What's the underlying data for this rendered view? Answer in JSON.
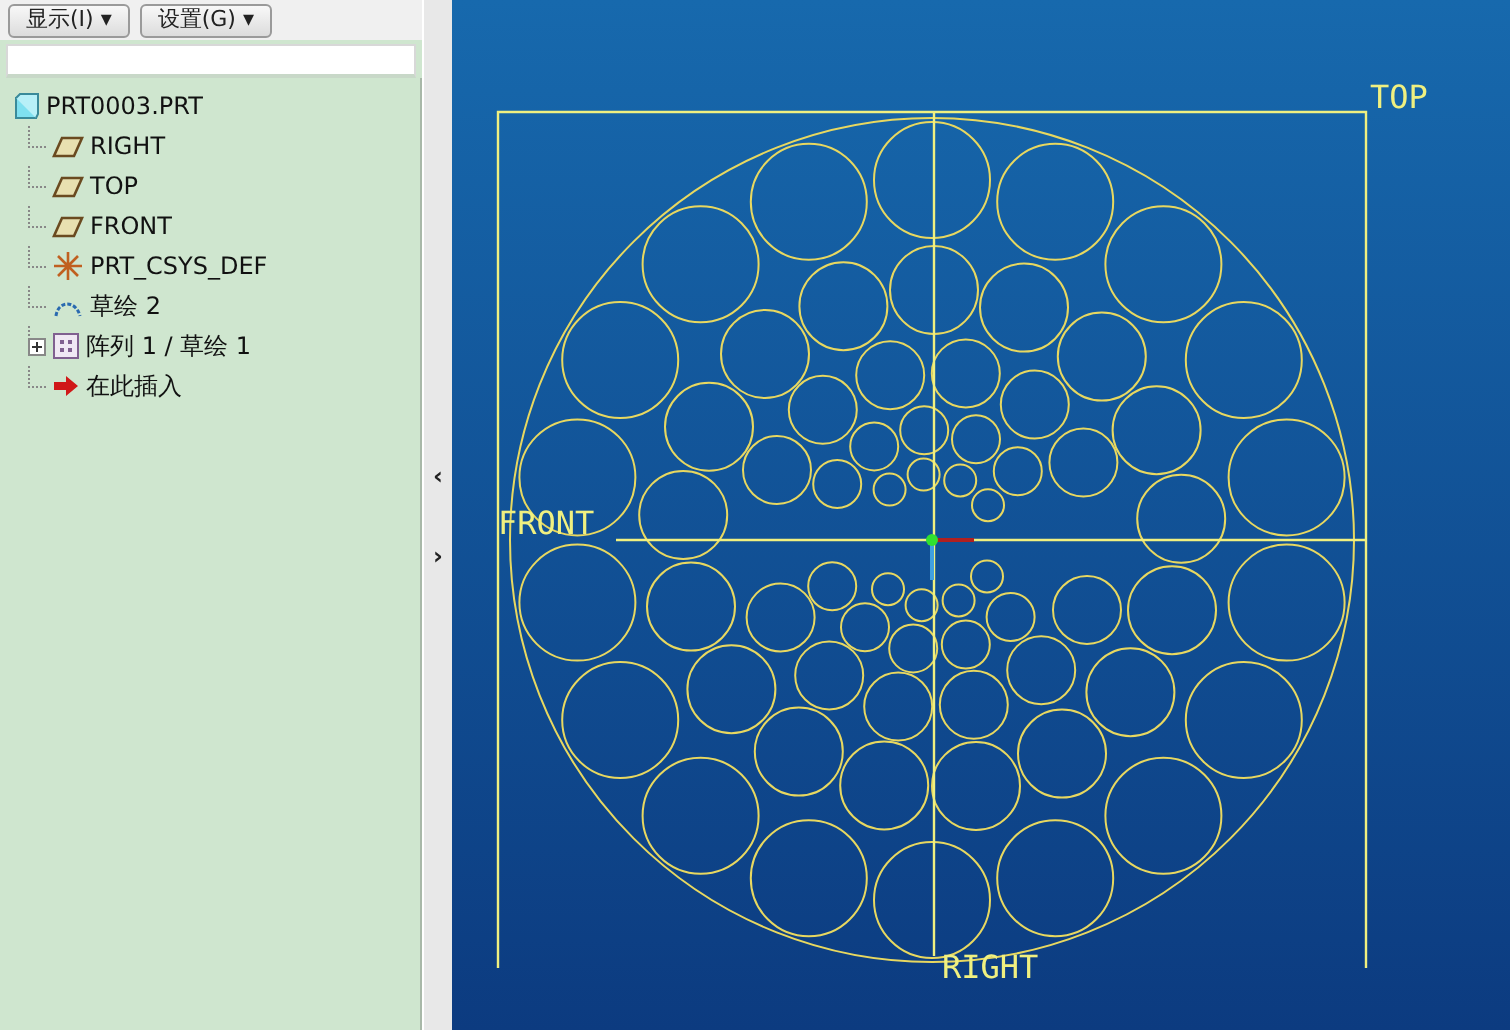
{
  "toolbar": {
    "buttons": [
      {
        "label": "显示(I)",
        "caret": "▾"
      },
      {
        "label": "设置(G)",
        "caret": "▾"
      }
    ]
  },
  "model_tree": {
    "root": {
      "label": "PRT0003.PRT",
      "kind": "part",
      "children": [
        {
          "label": "RIGHT",
          "kind": "plane"
        },
        {
          "label": "TOP",
          "kind": "plane"
        },
        {
          "label": "FRONT",
          "kind": "plane"
        },
        {
          "label": "PRT_CSYS_DEF",
          "kind": "csys"
        },
        {
          "label": "草绘 2",
          "kind": "sketch"
        },
        {
          "label": "阵列 1 / 草绘 1",
          "kind": "pattern",
          "expanded": false
        },
        {
          "label": "在此插入",
          "kind": "insert"
        }
      ]
    }
  },
  "splitter": {
    "collapse_glyph": "‹",
    "expand_glyph": "›"
  },
  "viewport": {
    "datum_labels": [
      {
        "label": "TOP",
        "kind": "top"
      },
      {
        "label": "FRONT",
        "kind": "front"
      },
      {
        "label": "RIGHT",
        "kind": "right"
      }
    ]
  }
}
